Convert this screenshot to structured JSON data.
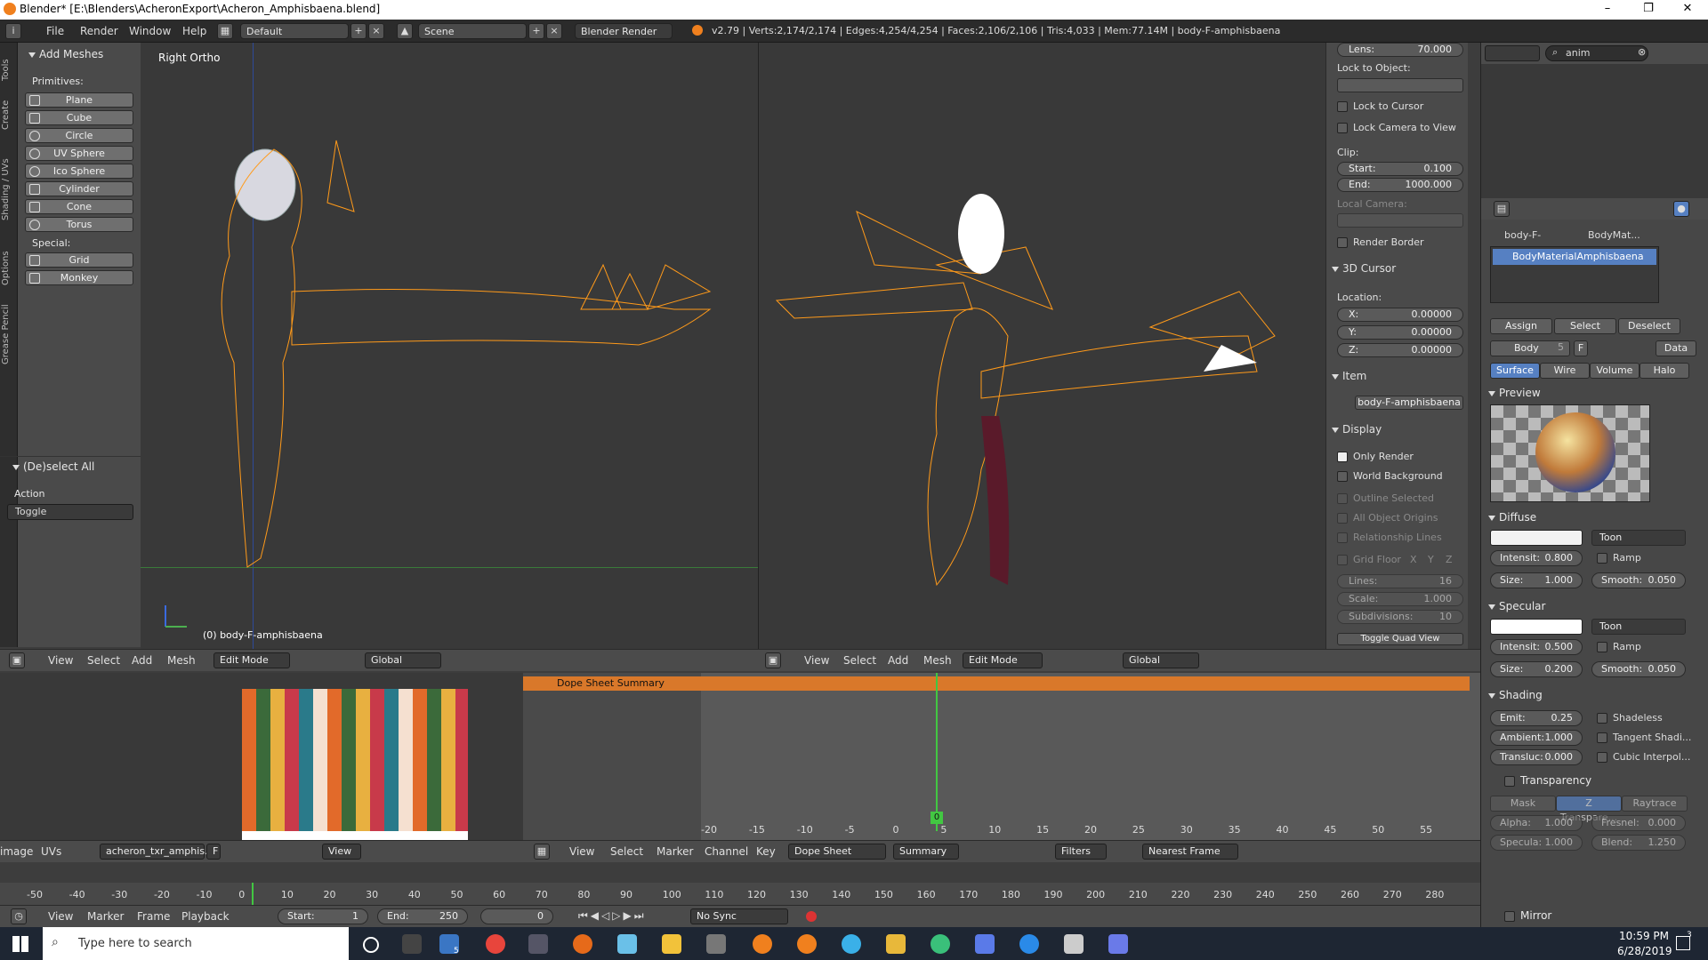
{
  "window": {
    "title": "Blender* [E:\\Blenders\\AcheronExport\\Acheron_Amphisbaena.blend]",
    "controls": {
      "minimize": "–",
      "maximize": "❐",
      "close": "✕"
    }
  },
  "infobar": {
    "menus": [
      "File",
      "Render",
      "Window",
      "Help"
    ],
    "layout": "Default",
    "scene": "Scene",
    "engine": "Blender Render",
    "stats": "v2.79 | Verts:2,174/2,174 | Edges:4,254/4,254 | Faces:2,106/2,106 | Tris:4,033 | Mem:77.14M | body-F-amphisbaena"
  },
  "toolshelf": {
    "tabs": [
      "Tools",
      "Create",
      "Shading / UVs",
      "Options",
      "Grease Pencil"
    ],
    "header": "Add Meshes",
    "primitives_label": "Primitives:",
    "primitives": [
      "Plane",
      "Cube",
      "Circle",
      "UV Sphere",
      "Ico Sphere",
      "Cylinder",
      "Cone",
      "Torus"
    ],
    "special_label": "Special:",
    "special": [
      "Grid",
      "Monkey"
    ],
    "operator_panel": "(De)select All",
    "action_label": "Action",
    "action_value": "Toggle"
  },
  "viewport_left": {
    "view_name": "Right Ortho",
    "object_label": "(0) body-F-amphisbaena",
    "header": {
      "menus": [
        "View",
        "Select",
        "Add",
        "Mesh"
      ],
      "mode": "Edit Mode",
      "orientation": "Global"
    }
  },
  "viewport_right": {
    "header": {
      "menus": [
        "View",
        "Select",
        "Add",
        "Mesh"
      ],
      "mode": "Edit Mode",
      "orientation": "Global"
    }
  },
  "npanel": {
    "lens_label": "Lens:",
    "lens_value": "70.000",
    "lock_to_object": "Lock to Object:",
    "lock_to_cursor": "Lock to Cursor",
    "lock_camera_to_view": "Lock Camera to View",
    "clip": "Clip:",
    "clip_start_label": "Start:",
    "clip_start": "0.100",
    "clip_end_label": "End:",
    "clip_end": "1000.000",
    "local_camera": "Local Camera:",
    "render_border": "Render Border",
    "cursor_section": "3D Cursor",
    "location": "Location:",
    "x_label": "X:",
    "x": "0.00000",
    "y_label": "Y:",
    "y": "0.00000",
    "z_label": "Z:",
    "z": "0.00000",
    "item_section": "Item",
    "item_name": "body-F-amphisbaena",
    "display_section": "Display",
    "only_render": "Only Render",
    "world_background": "World Background",
    "outline_selected": "Outline Selected",
    "all_object_origins": "All Object Origins",
    "relationship_lines": "Relationship Lines",
    "grid_floor": "Grid Floor",
    "gx": "X",
    "gy": "Y",
    "gz": "Z",
    "lines_label": "Lines:",
    "lines": "16",
    "scale_label": "Scale:",
    "scale": "1.000",
    "subdiv_label": "Subdivisions:",
    "subdiv": "10",
    "toggle_quad": "Toggle Quad View"
  },
  "outliner": {
    "search": "anim"
  },
  "properties": {
    "breadcrumb_obj": "body-F-",
    "breadcrumb_mat": "BodyMat...",
    "material_slot": "BodyMaterialAmphisbaena",
    "assign": "Assign",
    "select": "Select",
    "deselect": "Deselect",
    "mat_name": "Body",
    "users": "5",
    "fake": "F",
    "data": "Data",
    "tabs": [
      "Surface",
      "Wire",
      "Volume",
      "Halo"
    ],
    "preview": "Preview",
    "diffuse": "Diffuse",
    "diffuse_shader": "Toon",
    "d_intensity_label": "Intensit:",
    "d_intensity": "0.800",
    "ramp": "Ramp",
    "d_size_label": "Size:",
    "d_size": "1.000",
    "d_smooth_label": "Smooth:",
    "d_smooth": "0.050",
    "specular": "Specular",
    "spec_shader": "Toon",
    "s_intensity_label": "Intensit:",
    "s_intensity": "0.500",
    "s_size_label": "Size:",
    "s_size": "0.200",
    "s_smooth_label": "Smooth:",
    "s_smooth": "0.050",
    "shading": "Shading",
    "emit_label": "Emit:",
    "emit": "0.25",
    "shadeless": "Shadeless",
    "ambient_label": "Ambient:",
    "ambient": "1.000",
    "tangent": "Tangent Shadi...",
    "transluc_label": "Transluc:",
    "transluc": "0.000",
    "cubic": "Cubic Interpol...",
    "transparency": "Transparency",
    "t_mask": "Mask",
    "t_z": "Z Transpare...",
    "t_ray": "Raytrace",
    "alpha_label": "Alpha:",
    "alpha": "1.000",
    "fresnel_label": "Fresnel:",
    "fresnel": "0.000",
    "specula_label": "Specula:",
    "specula": "1.000",
    "blend_label": "Blend:",
    "blend": "1.250",
    "mirror": "Mirror"
  },
  "uv_editor": {
    "header": {
      "image": "image",
      "uvs": "UVs",
      "texture": "acheron_txr_amphis...",
      "f": "F",
      "view": "View"
    }
  },
  "dopesheet": {
    "summary": "Dope Sheet Summary",
    "frame_marker": "0",
    "ruler": [
      "-20",
      "-15",
      "-10",
      "-5",
      "0",
      "5",
      "10",
      "15",
      "20",
      "25",
      "30",
      "35",
      "40",
      "45",
      "50",
      "55"
    ],
    "header": {
      "menus": [
        "View",
        "Select",
        "Marker",
        "Channel",
        "Key"
      ],
      "mode": "Dope Sheet",
      "summary_btn": "Summary",
      "filters": "Filters",
      "snap": "Nearest Frame"
    }
  },
  "timeline": {
    "ruler": [
      "-50",
      "-40",
      "-30",
      "-20",
      "-10",
      "0",
      "10",
      "20",
      "30",
      "40",
      "50",
      "60",
      "70",
      "80",
      "90",
      "100",
      "110",
      "120",
      "130",
      "140",
      "150",
      "160",
      "170",
      "180",
      "190",
      "200",
      "210",
      "220",
      "230",
      "240",
      "250",
      "260",
      "270",
      "280"
    ],
    "menus": [
      "View",
      "Marker",
      "Frame",
      "Playback"
    ],
    "start_label": "Start:",
    "start": "1",
    "end_label": "End:",
    "end": "250",
    "current": "0",
    "sync": "No Sync"
  },
  "taskbar": {
    "search_placeholder": "Type here to search",
    "mail_badge": "5",
    "time": "10:59 PM",
    "date": "6/28/2019",
    "notif": "3"
  },
  "colors": {
    "accent": "#5680c2",
    "header": "#4b4b4b",
    "orange": "#f5a623"
  }
}
